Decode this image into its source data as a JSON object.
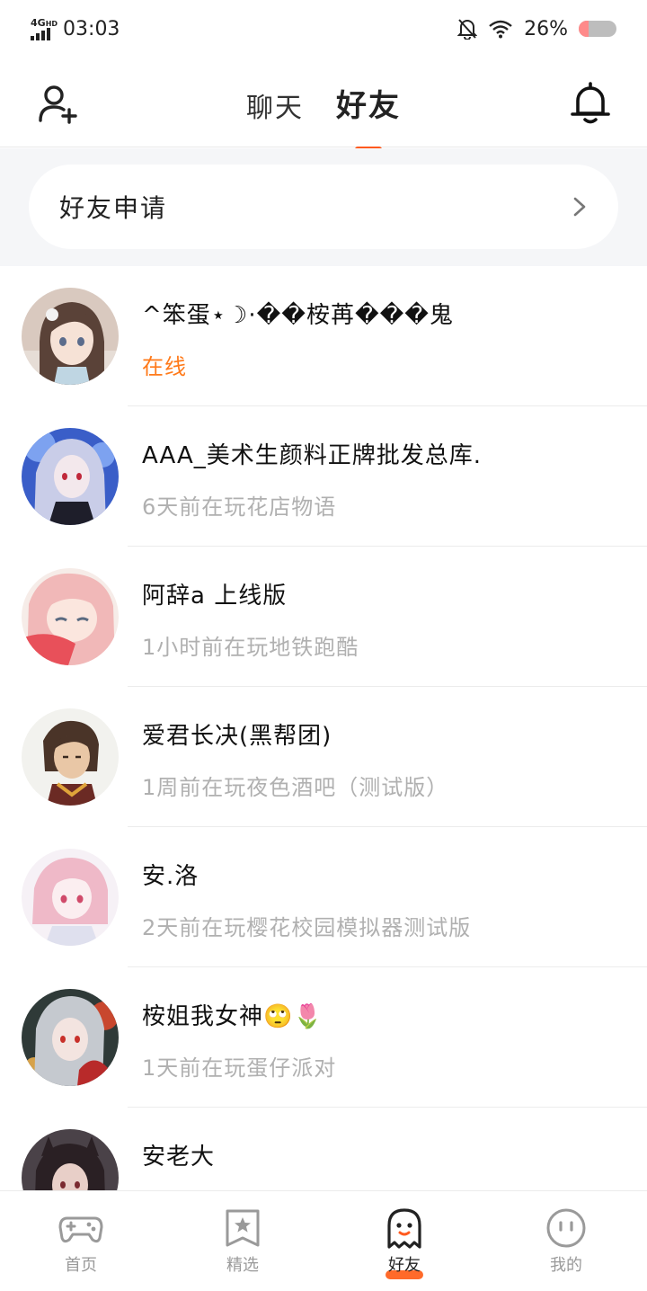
{
  "status_bar": {
    "network": "4G",
    "network_sub": "HD",
    "time": "03:03",
    "battery": "26%",
    "battery_level": 0.26
  },
  "header": {
    "tabs": [
      {
        "label": "聊天",
        "active": false
      },
      {
        "label": "好友",
        "active": true
      }
    ],
    "add_friend_icon": "add-user-icon",
    "bell_icon": "bell-icon"
  },
  "friend_request": {
    "label": "好友申请",
    "chevron_icon": "chevron-right-icon"
  },
  "friends": [
    {
      "name": "^笨蛋⋆☽·��桉苒���鬼",
      "status": "在线",
      "online": true
    },
    {
      "name": "AAA_美术生颜料正牌批发总库.",
      "status": "6天前在玩花店物语",
      "online": false
    },
    {
      "name": "阿辞a   上线版",
      "status": "1小时前在玩地铁跑酷",
      "online": false
    },
    {
      "name": "爱君长决(黑帮团)",
      "status": "1周前在玩夜色酒吧（测试版）",
      "online": false
    },
    {
      "name": "安.洛",
      "status": "2天前在玩樱花校园模拟器测试版",
      "online": false
    },
    {
      "name": "桉姐我女神🙄🌷",
      "status": "1天前在玩蛋仔派对",
      "online": false
    },
    {
      "name": "安老大",
      "status": "",
      "online": false
    }
  ],
  "bottom_nav": [
    {
      "label": "首页",
      "icon": "gamepad-icon",
      "active": false
    },
    {
      "label": "精选",
      "icon": "star-bookmark-icon",
      "active": false
    },
    {
      "label": "好友",
      "icon": "ghost-icon",
      "active": true
    },
    {
      "label": "我的",
      "icon": "face-icon",
      "active": false
    }
  ],
  "colors": {
    "accent": "#ff5a1f",
    "online": "#ff7a1a",
    "muted_text": "#b0b0b0"
  }
}
